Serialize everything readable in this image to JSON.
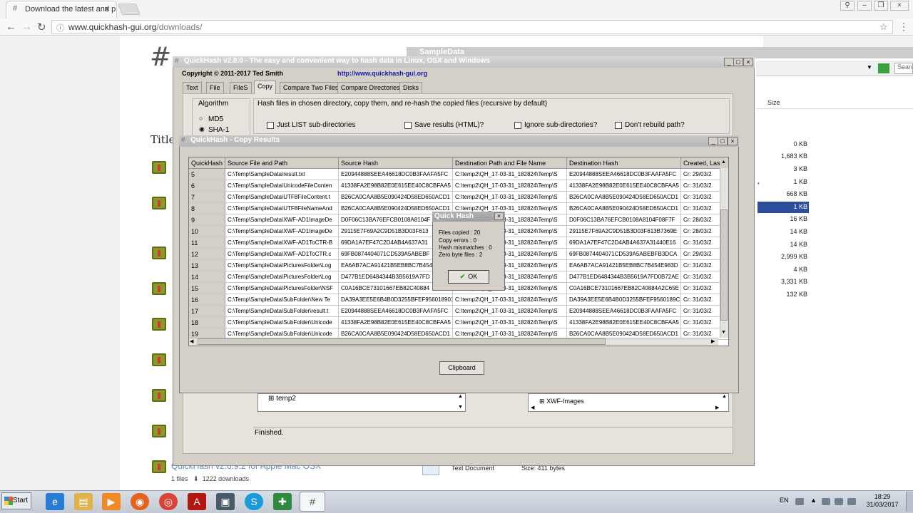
{
  "browser": {
    "tab_title": "Download the latest and p",
    "tab_favicon": "#",
    "url_host": "www.quickhash-gui.org",
    "url_path": "/downloads/"
  },
  "webpage": {
    "logo": "#",
    "title_label": "Title",
    "bottom_link": "QuickHash v2.6.9.2 for Apple Mac OSX",
    "files_count": "1 files",
    "downloads_count": "1222 downloads"
  },
  "explorer": {
    "title": "SampleData",
    "search_placeholder": "Searc",
    "size_header": "Size",
    "sizes": [
      "0 KB",
      "1,683 KB",
      "3 KB",
      "1 KB",
      "668 KB",
      "1 KB",
      "16 KB",
      "14 KB",
      "14 KB",
      "2,999 KB",
      "4 KB",
      "3,331 KB",
      "132 KB"
    ],
    "bottom_type": "Text Document",
    "bottom_size": "Size: 411 bytes"
  },
  "quickhash": {
    "title": "QuickHash v2.8.0 - The easy and convenient way to hash data in Linux, OSX and Windows",
    "copyright": "Copyright © 2011-2017  Ted Smith",
    "url": "http://www.quickhash-gui.org",
    "tabs": [
      "Text",
      "File",
      "FileS",
      "Copy",
      "Compare Two Files",
      "Compare Directories",
      "Disks"
    ],
    "algorithm_label": "Algorithm",
    "alg_md5": "MD5",
    "alg_sha1": "SHA-1",
    "group_label": "Hash files in chosen directory, copy them, and re-hash the copied files (recursive by default)",
    "options": [
      "Just LIST sub-directories",
      "Save results (HTML)?",
      "Ignore sub-directories?",
      "Don't rebuild path?"
    ],
    "tree_left": "temp2",
    "tree_right": "XWF-Images",
    "status": "Finished."
  },
  "copy_results": {
    "title": "QuickHash - Copy Results",
    "columns": [
      "QuickHash v",
      "Source File and Path",
      "Source Hash",
      "Destination Path and File Name",
      "Destination Hash",
      "Created, Las"
    ],
    "rows": [
      [
        "5",
        "C:\\Temp\\SampleData\\result.txt",
        "E20944888SEEA46618DC0B3FAAFA5FC",
        "C:\\temp2\\QH_17-03-31_182824\\Temp\\S",
        "E20944888SEEA46618DC0B3FAAFA5FC",
        "Cr: 29/03/2"
      ],
      [
        "6",
        "C:\\Temp\\SampleData\\UnicodeFileConten",
        "41338FA2E98B82E0E615EE40C8CBFAA5",
        "C:\\temp2\\QH_17-03-31_182824\\Temp\\S",
        "41338FA2E98B82E0E615EE40C8CBFAA5",
        "Cr: 31/03/2"
      ],
      [
        "7",
        "C:\\Temp\\SampleData\\UTF8FileContent.t",
        "B26CA0CAA8B5E090424D58ED650ACD1",
        "C:\\temp2\\QH_17-03-31_182824\\Temp\\S",
        "B26CA0CAA8B5E090424D58ED650ACD1",
        "Cr: 31/03/2"
      ],
      [
        "8",
        "C:\\Temp\\SampleData\\UTF8FileNameAnd",
        "B26CA0CAA8B5E090424D58ED650ACD1",
        "C:\\temp2\\QH_17-03-31_182824\\Temp\\S",
        "B26CA0CAA8B5E090424D58ED650ACD1",
        "Cr: 31/03/2"
      ],
      [
        "9",
        "C:\\Temp\\SampleData\\XWF-AD1ImageDe",
        "D0F06C13BA76EFCB0108A8104F",
        "C:\\temp2\\QH_17-03-31_182824\\Temp\\S",
        "D0F06C13BA76EFCB0108A8104F08F7F",
        "Cr: 28/03/2"
      ],
      [
        "10",
        "C:\\Temp\\SampleData\\XWF-AD1ImageDe",
        "29115E7F69A2C9D51B3D03F613",
        "C:\\temp2\\QH_17-03-31_182824\\Temp\\S",
        "29115E7F69A2C9D51B3D03F613B7369E",
        "Cr: 28/03/2"
      ],
      [
        "11",
        "C:\\Temp\\SampleData\\XWF-AD1ToCTR-B",
        "69DA1A7EF47C2D4AB4A637A31",
        "C:\\temp2\\QH_17-03-31_182824\\Temp\\S",
        "69DA1A7EF47C2D4AB4A637A31440E16",
        "Cr: 31/03/2"
      ],
      [
        "12",
        "C:\\Temp\\SampleData\\XWF-AD1ToCTR.c",
        "69FB0874404071CD539A5ABEBF",
        "C:\\temp2\\QH_17-03-31_182824\\Temp\\S",
        "69FB0874404071CD539A5ABEBFB3DCA",
        "Cr: 29/03/2"
      ],
      [
        "13",
        "C:\\Temp\\SampleData\\PicturesFolder\\Log",
        "EA6AB7ACA91421B5EB8BC7B454",
        "C:\\temp2\\QH_17-03-31_182824\\Temp\\S",
        "EA6AB7ACA91421B5EB8BC7B454E983D",
        "Cr: 31/03/2"
      ],
      [
        "14",
        "C:\\Temp\\SampleData\\PicturesFolder\\Log",
        "D477B1ED6484344B3B5619A7FD",
        "C:\\temp2\\QH_17-03-31_182824\\Temp\\S",
        "D477B1ED6484344B3B5619A7FD0B72AE",
        "Cr: 31/03/2"
      ],
      [
        "15",
        "C:\\Temp\\SampleData\\PicturesFolder\\NSF",
        "C0A16BCE73101667EB82C40884",
        "C:\\temp2\\QH_17-03-31_182824\\Temp\\S",
        "C0A16BCE73101667EB82C40884A2C65E",
        "Cr: 31/03/2"
      ],
      [
        "16",
        "C:\\Temp\\SampleData\\SubFolder\\New Te",
        "DA39A3EE5E6B4B0D3255BFEF956018901",
        "C:\\temp2\\QH_17-03-31_182824\\Temp\\S",
        "DA39A3EE5E6B4B0D3255BFEF9560189C",
        "Cr: 31/03/2"
      ],
      [
        "17",
        "C:\\Temp\\SampleData\\SubFolder\\result.t",
        "E20944888SEEA46618DC0B3FAAFA5FC",
        "C:\\temp2\\QH_17-03-31_182824\\Temp\\S",
        "E20944888SEEA46618DC0B3FAAFA5FC",
        "Cr: 31/03/2"
      ],
      [
        "18",
        "C:\\Temp\\SampleData\\SubFolder\\Unicode",
        "41338FA2E98B82E0E615EE40C8CBFAA5",
        "C:\\temp2\\QH_17-03-31_182824\\Temp\\S",
        "41338FA2E98B82E0E615EE40C8CBFAA5",
        "Cr: 31/03/2"
      ],
      [
        "19",
        "C:\\Temp\\SampleData\\SubFolder\\Unicode",
        "B26CA0CAA8B5E090424D58ED650ACD1",
        "C:\\temp2\\QH_17-03-31_182824\\Temp\\S",
        "B26CA0CAA8B5E090424D58ED650ACD1",
        "Cr: 31/03/2"
      ]
    ],
    "clipboard_label": "Clipboard"
  },
  "dialog": {
    "title": "Quick Hash",
    "files_copied": "Files copied : 20",
    "copy_errors": "Copy errors : 0",
    "hash_mismatches": "Hash mismatches : 0",
    "zero_byte_files": "Zero byte files : 2",
    "ok_label": "OK"
  },
  "taskbar": {
    "start_label": "Start",
    "language": "EN",
    "time": "18:29",
    "date": "31/03/2017"
  },
  "colors": {
    "selection": "#2c4e9c",
    "link": "#1a1aa8",
    "ok_check": "#3a9a30"
  }
}
